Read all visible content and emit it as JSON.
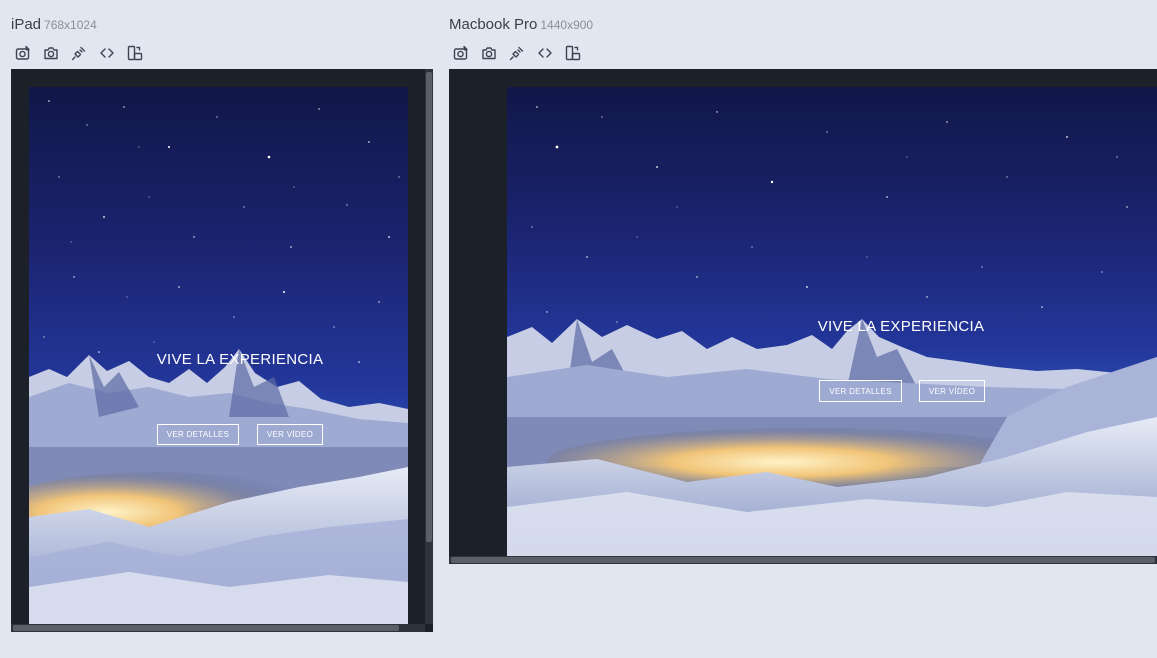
{
  "devices": [
    {
      "name": "iPad",
      "dimensions": "768x1024",
      "tools": [
        "screenshot-edit-icon",
        "camera-icon",
        "plug-icon",
        "code-icon",
        "rotate-device-icon"
      ],
      "hero": {
        "title": "VIVE LA EXPERIENCIA",
        "details_button": "VER DETALLES",
        "video_button": "VER VÍDEO"
      }
    },
    {
      "name": "Macbook Pro",
      "dimensions": "1440x900",
      "tools": [
        "screenshot-edit-icon",
        "camera-icon",
        "plug-icon",
        "code-icon",
        "rotate-device-icon"
      ],
      "hero": {
        "title": "VIVE LA EXPERIENCIA",
        "details_button": "VER DETALLES",
        "video_button": "VER VÍDEO"
      }
    }
  ]
}
